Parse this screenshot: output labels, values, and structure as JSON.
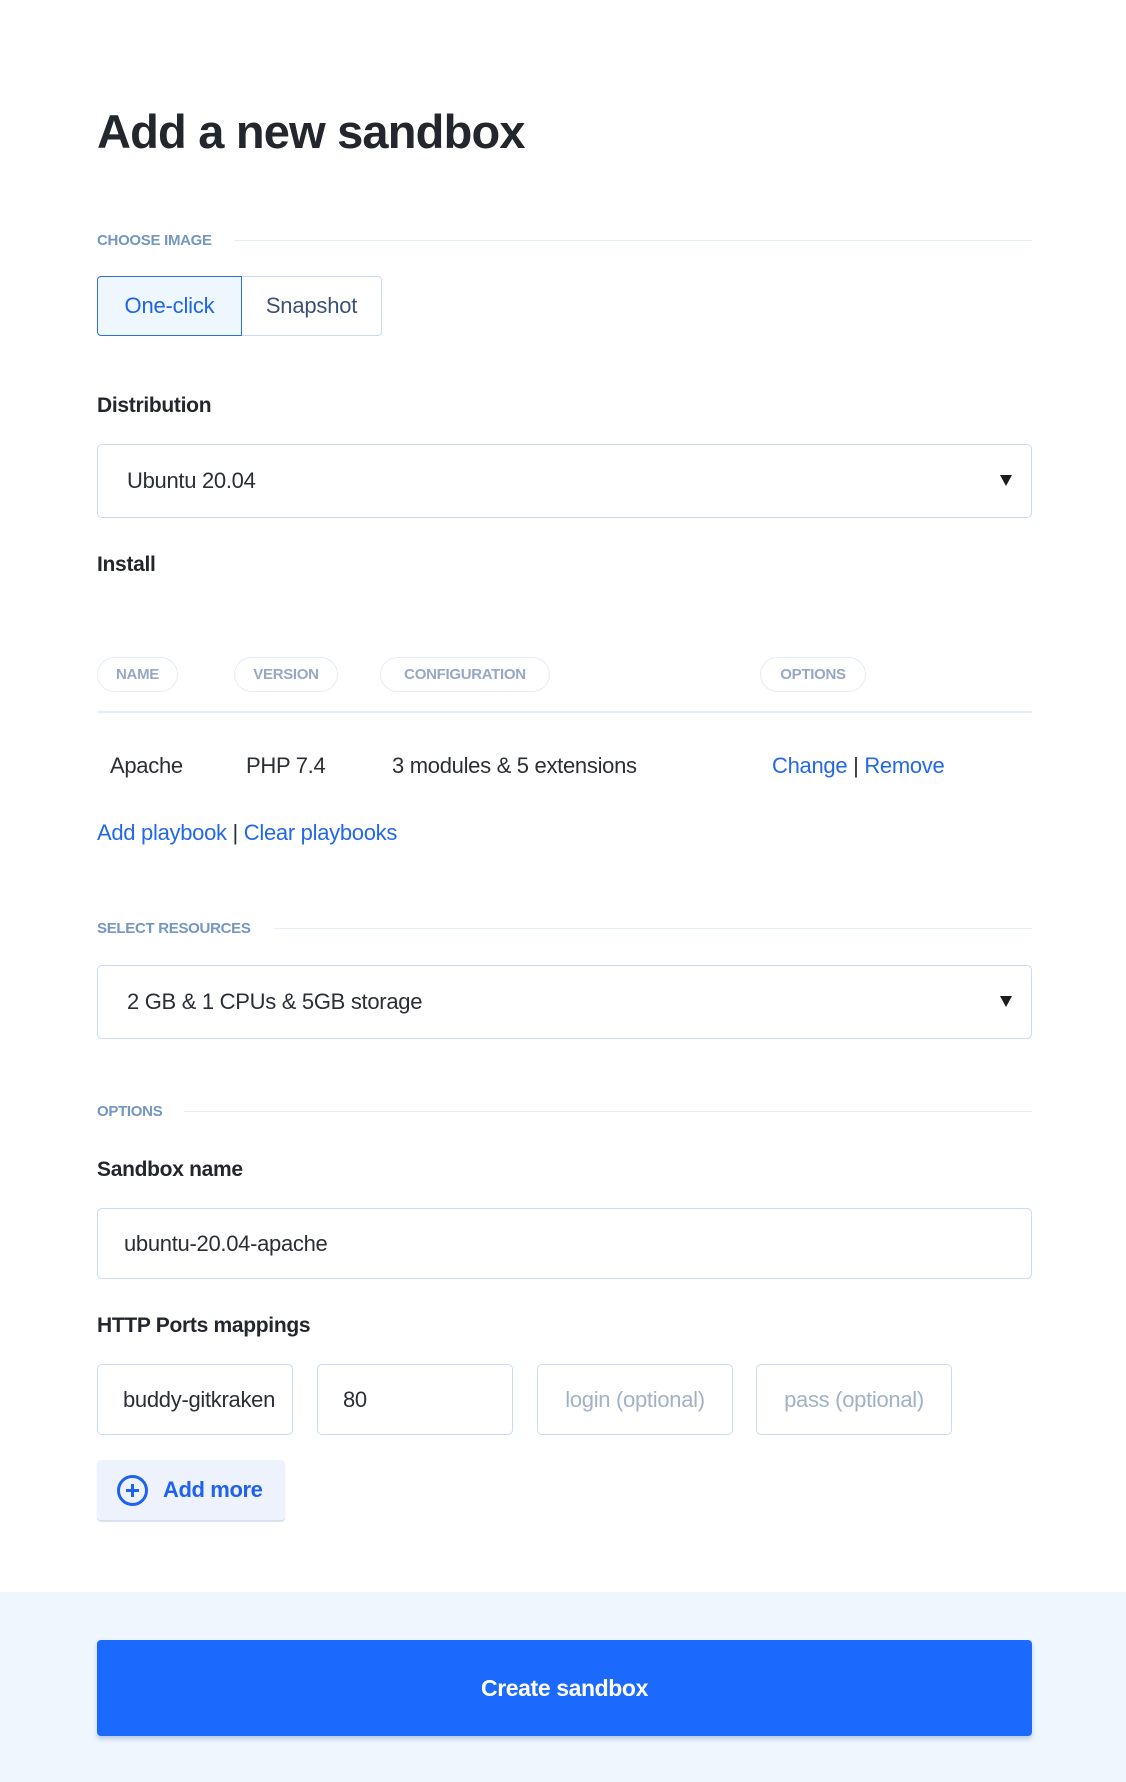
{
  "page": {
    "title": "Add a new sandbox"
  },
  "choose_image": {
    "section_label": "CHOOSE IMAGE",
    "options": [
      "One-click",
      "Snapshot"
    ],
    "selected": "One-click"
  },
  "distribution": {
    "label": "Distribution",
    "selected": "Ubuntu 20.04"
  },
  "install": {
    "label": "Install",
    "columns": [
      "NAME",
      "VERSION",
      "CONFIGURATION",
      "OPTIONS"
    ],
    "rows": [
      {
        "name": "Apache",
        "version": "PHP 7.4",
        "configuration": "3 modules & 5 extensions",
        "actions": [
          "Change",
          "Remove"
        ]
      }
    ],
    "separator": "|",
    "links": [
      "Add playbook",
      "Clear playbooks"
    ]
  },
  "resources": {
    "section_label": "SELECT RESOURCES",
    "selected": "2 GB & 1 CPUs & 5GB storage"
  },
  "options": {
    "section_label": "OPTIONS",
    "sandbox_name": {
      "label": "Sandbox name",
      "value": "ubuntu-20.04-apache"
    },
    "http_ports": {
      "label": "HTTP Ports mappings",
      "mapping": {
        "subdomain": "buddy-gitkraken",
        "port": "80",
        "login_placeholder": "login (optional)",
        "pass_placeholder": "pass (optional)"
      },
      "add_more_label": "Add more"
    }
  },
  "footer": {
    "create_label": "Create sandbox"
  },
  "colors": {
    "accent": "#1c69fe",
    "link": "#2368e8",
    "section_label": "#7396c3",
    "footer_bg": "#eef6fe"
  }
}
